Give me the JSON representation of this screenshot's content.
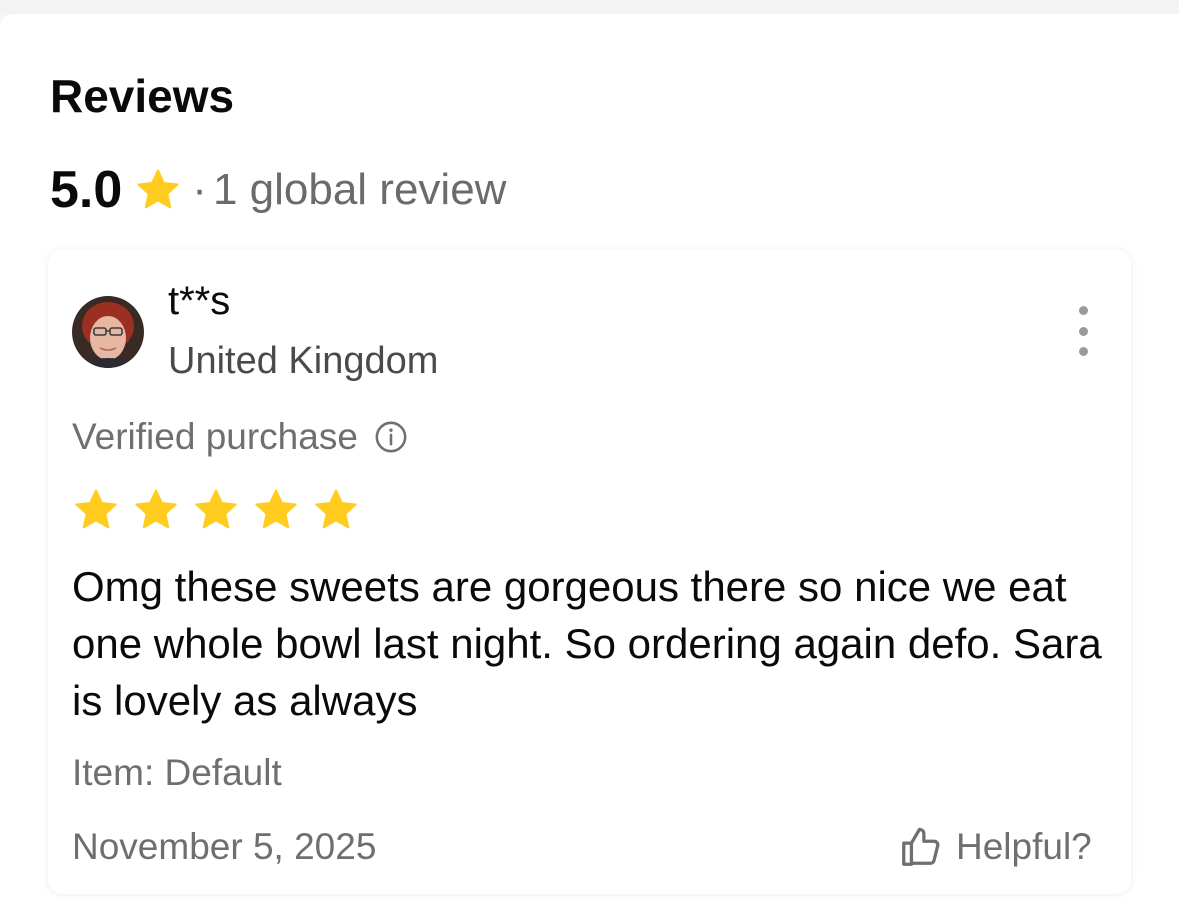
{
  "reviews": {
    "title": "Reviews",
    "summary": {
      "rating": "5.0",
      "separator": "·",
      "count_text": "1 global review",
      "star_icon": "star-icon"
    },
    "colors": {
      "star": "#FFCC1F",
      "muted_text": "#6f6f6f",
      "primary_text": "#0a0a0a"
    },
    "items": [
      {
        "username": "t**s",
        "country": "United Kingdom",
        "avatar_icon": "user-avatar",
        "menu_icon": "more-vertical-icon",
        "verified_label": "Verified purchase",
        "verified_icon": "info-icon",
        "stars": 5,
        "text": "Omg these sweets are gorgeous there so nice we eat one whole bowl last night. So ordering again defo. Sara is lovely as always",
        "item_variant": "Item: Default",
        "date": "November 5, 2025",
        "helpful_label": "Helpful?",
        "helpful_icon": "thumbs-up-icon"
      }
    ]
  }
}
